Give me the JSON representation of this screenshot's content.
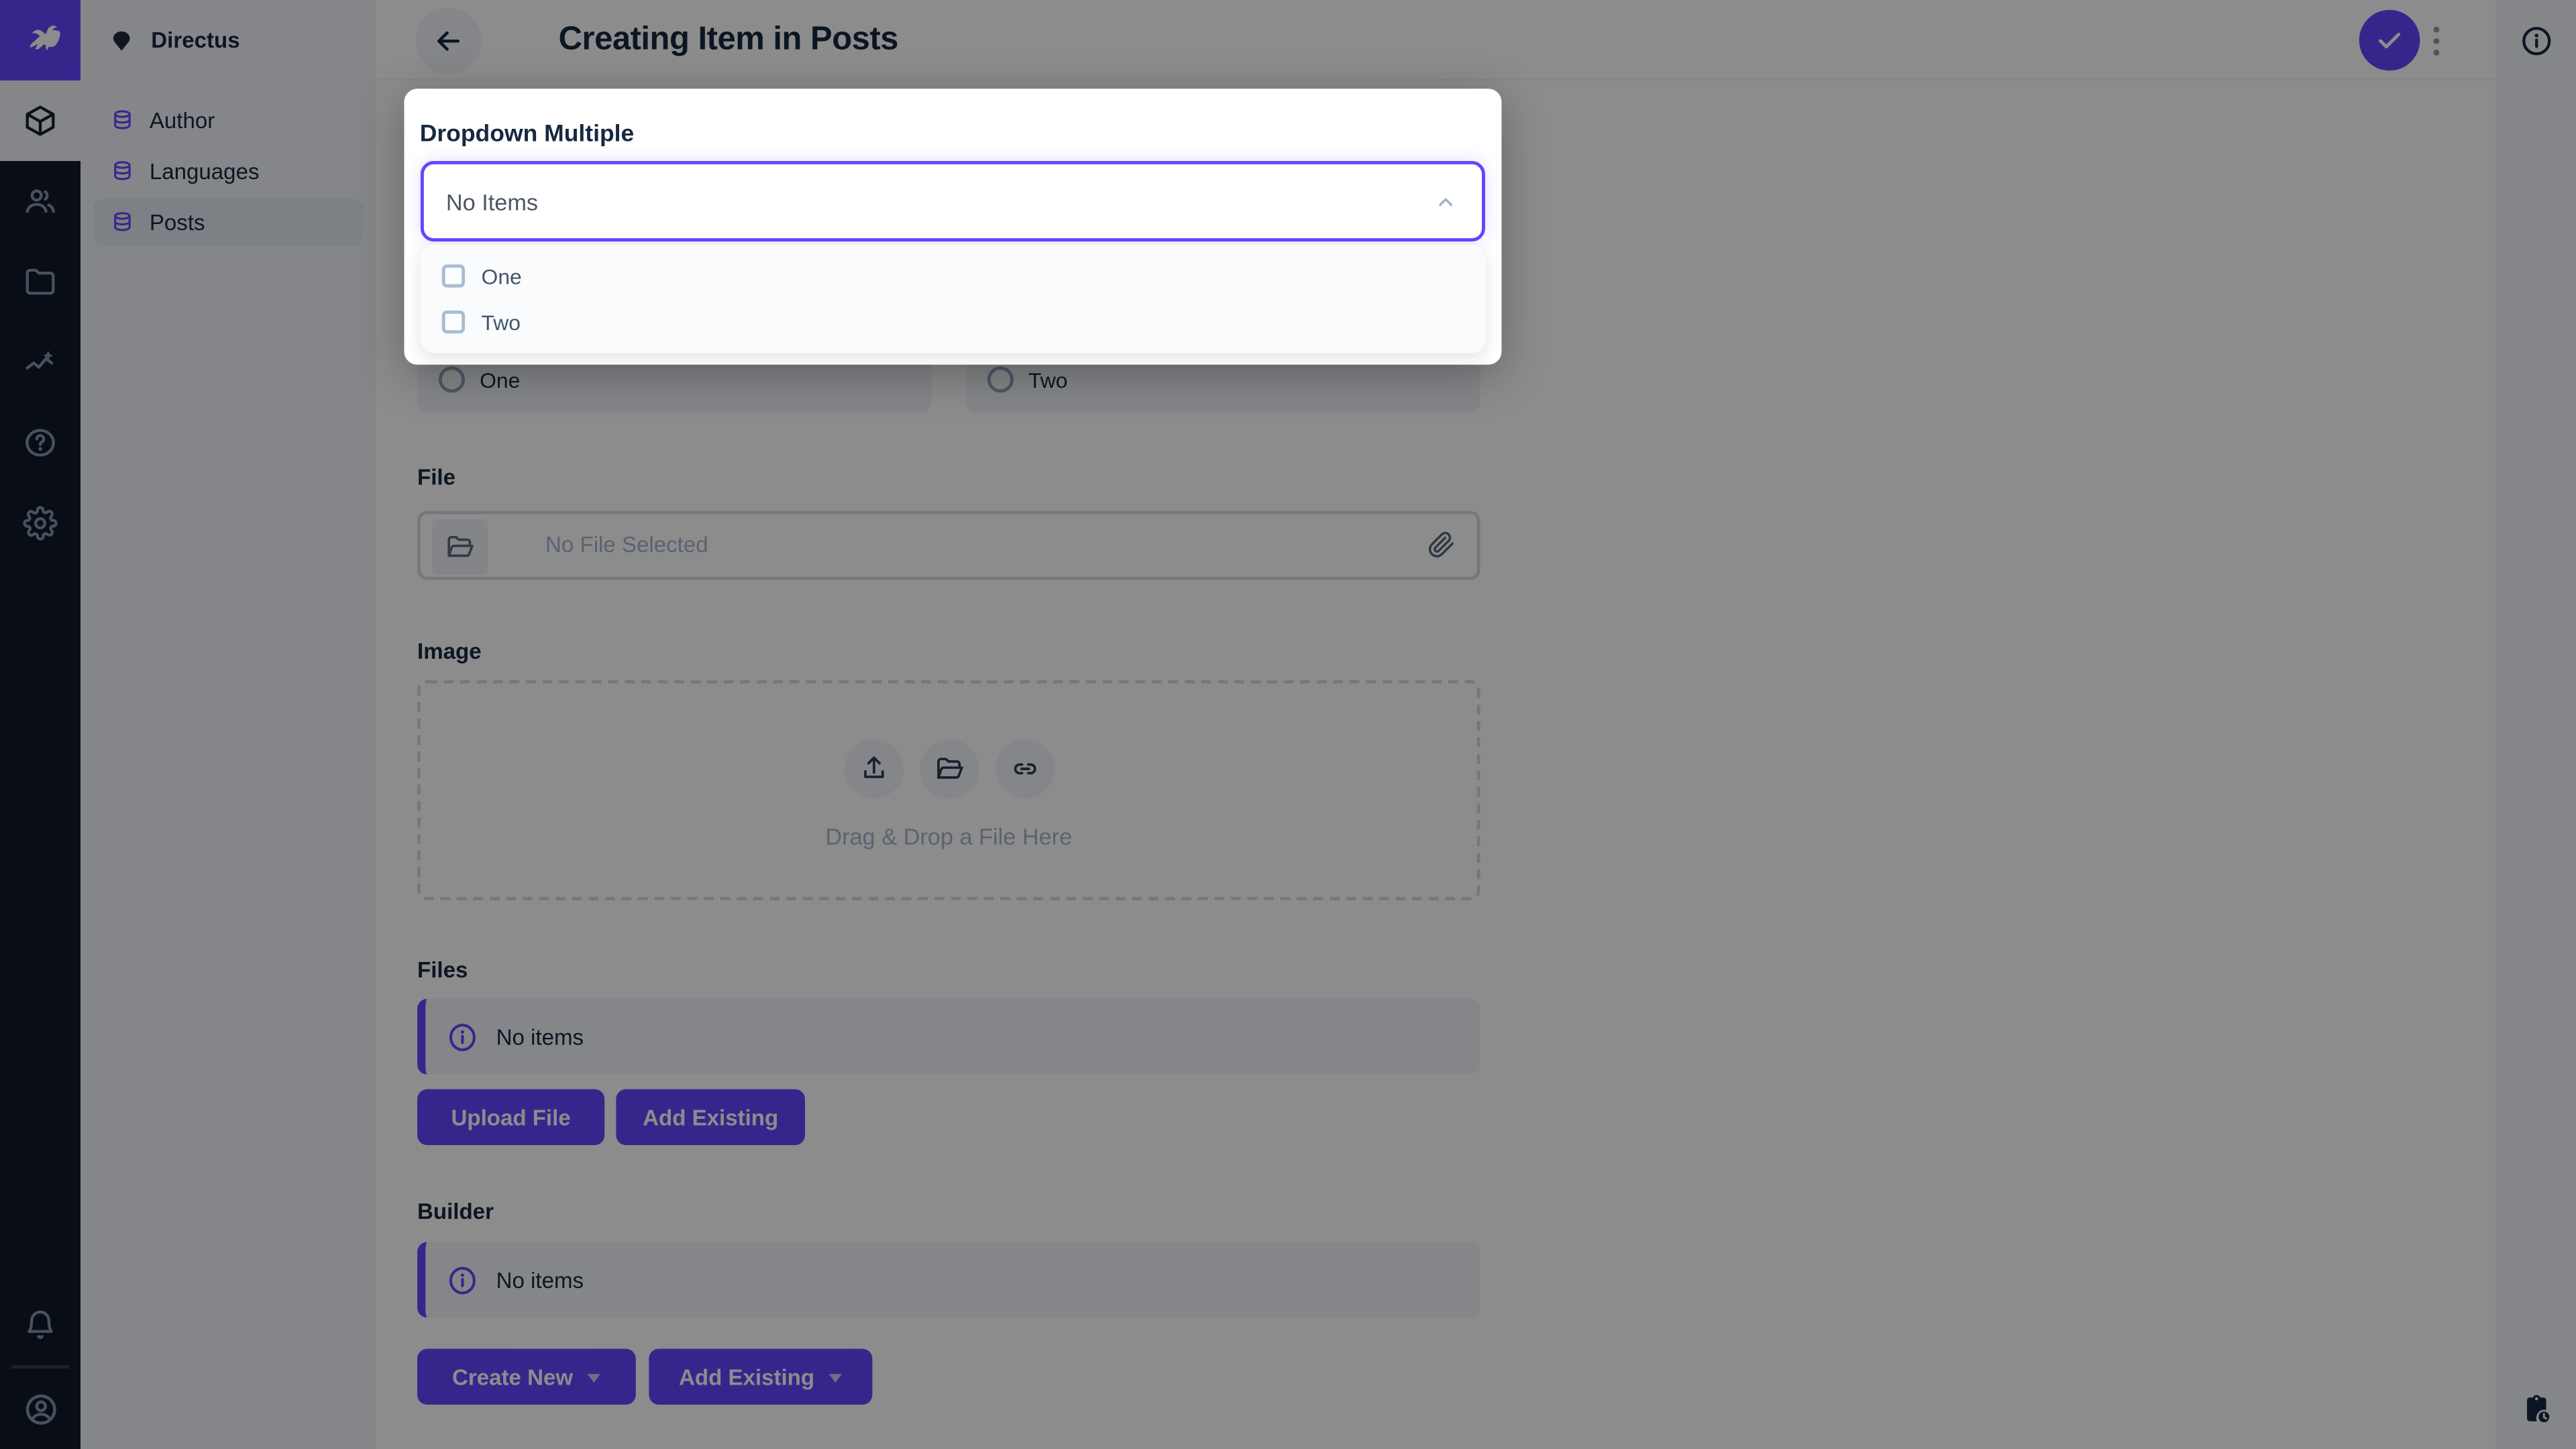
{
  "app": {
    "project_name": "Directus",
    "page_title": "Creating Item in Posts"
  },
  "colors": {
    "accent_purple": "#6644FF",
    "module_bar_bg": "#121A29",
    "nav_bg": "#F0F4F9",
    "nav_active_bg": "#E4EAF1",
    "text_dark": "#172940",
    "text_subdued": "#A2B5CD",
    "input_border": "#D3DAE4",
    "overlay": "rgba(0,0,0,0.45)"
  },
  "module_bar": {
    "logo_icon": "rabbit-logo",
    "modules": [
      {
        "icon": "box-icon",
        "active": true
      },
      {
        "icon": "people-icon",
        "active": false
      },
      {
        "icon": "folder-icon",
        "active": false
      },
      {
        "icon": "insights-icon",
        "active": false
      },
      {
        "icon": "help-icon",
        "active": false
      },
      {
        "icon": "settings-icon",
        "active": false
      }
    ],
    "bottom_icons": [
      "bell-icon",
      "user-circle-icon"
    ]
  },
  "nav": {
    "project_icon": "diamond-icon",
    "items": [
      {
        "label": "Author",
        "active": false
      },
      {
        "label": "Languages",
        "active": false
      },
      {
        "label": "Posts",
        "active": true
      }
    ]
  },
  "header": {
    "actions": [
      "back-arrow-icon",
      "check-save-icon",
      "more-vertical-icon"
    ]
  },
  "right_strip": {
    "top_icon": "info-circle-icon",
    "bottom_icon": "clipboard-clock-icon"
  },
  "dropdown_field": {
    "label": "Dropdown Multiple",
    "value": "No Items",
    "state": "open",
    "options": [
      {
        "label": "One",
        "checked": false
      },
      {
        "label": "Two",
        "checked": false
      }
    ]
  },
  "radio_field": {
    "options": [
      {
        "label": "One",
        "selected": false
      },
      {
        "label": "Two",
        "selected": false
      }
    ]
  },
  "file_field": {
    "label": "File",
    "placeholder": "No File Selected"
  },
  "image_field": {
    "label": "Image",
    "dropzone_text": "Drag & Drop a File Here",
    "action_icons": [
      "upload-icon",
      "folder-open-icon",
      "link-icon"
    ]
  },
  "files_field": {
    "label": "Files",
    "empty_text": "No items",
    "buttons": [
      "Upload File",
      "Add Existing"
    ]
  },
  "builder_field": {
    "label": "Builder",
    "empty_text": "No items",
    "buttons": [
      "Create New",
      "Add Existing"
    ]
  }
}
